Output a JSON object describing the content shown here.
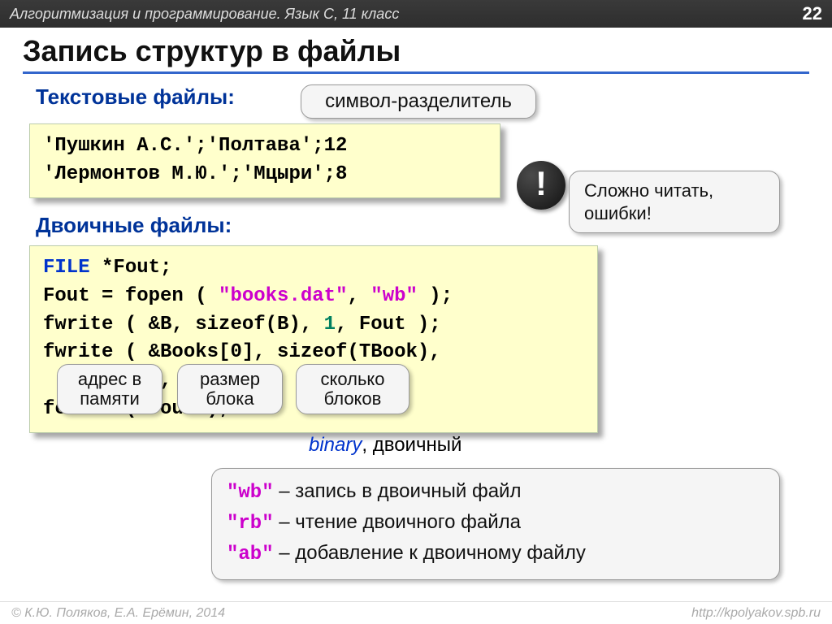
{
  "topbar": {
    "text": "Алгоритмизация и программирование. Язык С, 11 класс",
    "page": "22"
  },
  "title": "Запись структур в файлы",
  "subheading_text": "Текстовые файлы:",
  "subheading_binary": "Двоичные файлы:",
  "code1": {
    "line1": "'Пушкин А.С.';'Полтава';12",
    "line2": "'Лермонтов М.Ю.';'Мцыри';8"
  },
  "code2": {
    "l1a": "FILE",
    "l1b": " *Fout;",
    "l2a": "Fout = fopen ( ",
    "l2b": "\"books.dat\"",
    "l2c": ", ",
    "l2d": "\"wb\"",
    "l2e": " );",
    "l3a": "fwrite ( &B, sizeof(B), ",
    "l3b": "1",
    "l3c": ", Fout );",
    "l4a": "fwrite ( &Books[0], sizeof(TBook),",
    "l5a": "         ",
    "l5b": "5",
    "l5c": ", Fout );",
    "l6": "fclose ( Fout );"
  },
  "callouts": {
    "separator": "символ-разделитель",
    "bad": "Сложно читать, ошибки!",
    "addr": "адрес в памяти",
    "size": "размер блока",
    "count": "сколько блоков"
  },
  "badge": "!",
  "binlabel": {
    "it": "binary",
    "rest": ", двоичный"
  },
  "modes": {
    "wb_code": "\"wb\"",
    "wb_text": " – запись в двоичный файл",
    "rb_code": "\"rb\"",
    "rb_text": " – чтение двоичного файла",
    "ab_code": "\"ab\"",
    "ab_text": " – добавление к двоичному файлу"
  },
  "footer": {
    "left": "© К.Ю. Поляков, Е.А. Ерёмин, 2014",
    "right": "http://kpolyakov.spb.ru"
  }
}
